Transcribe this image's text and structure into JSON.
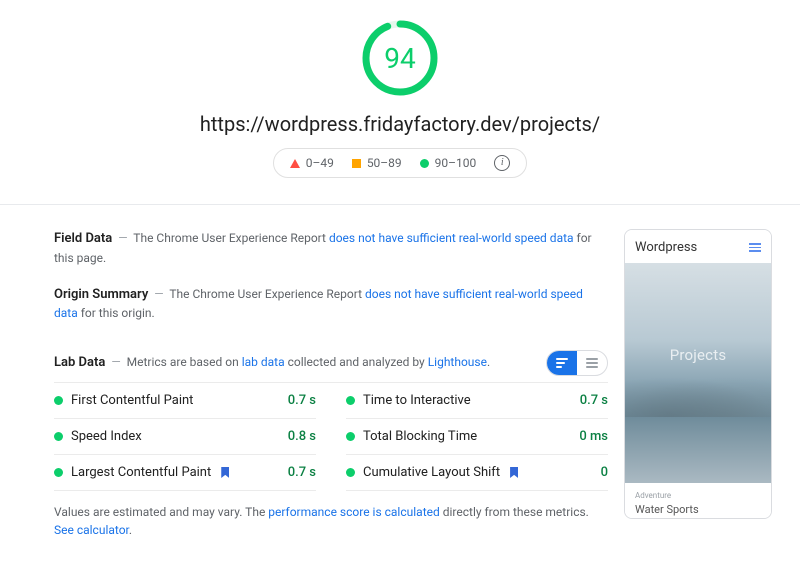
{
  "score": "94",
  "url": "https://wordpress.fridayfactory.dev/projects/",
  "legend": {
    "low": "0–49",
    "mid": "50–89",
    "high": "90–100"
  },
  "fieldData": {
    "title": "Field Data",
    "prefix": "The Chrome User Experience Report ",
    "link": "does not have sufficient real-world speed data",
    "suffix": " for this page."
  },
  "originSummary": {
    "title": "Origin Summary",
    "prefix": "The Chrome User Experience Report ",
    "link": "does not have sufficient real-world speed data",
    "suffix": " for this origin."
  },
  "labData": {
    "title": "Lab Data",
    "prefix": "Metrics are based on ",
    "link1": "lab data",
    "mid": " collected and analyzed by ",
    "link2": "Lighthouse",
    "suffix": "."
  },
  "metrics": [
    {
      "name": "First Contentful Paint",
      "value": "0.7 s",
      "bookmark": false
    },
    {
      "name": "Time to Interactive",
      "value": "0.7 s",
      "bookmark": false
    },
    {
      "name": "Speed Index",
      "value": "0.8 s",
      "bookmark": false
    },
    {
      "name": "Total Blocking Time",
      "value": "0 ms",
      "bookmark": false
    },
    {
      "name": "Largest Contentful Paint",
      "value": "0.7 s",
      "bookmark": true
    },
    {
      "name": "Cumulative Layout Shift",
      "value": "0",
      "bookmark": true
    }
  ],
  "footnote": {
    "prefix": "Values are estimated and may vary. The ",
    "link1": "performance score is calculated",
    "mid": " directly from these metrics. ",
    "link2": "See calculator",
    "suffix": "."
  },
  "preview": {
    "siteName": "Wordpress",
    "heroText": "Projects",
    "tag": "Adventure",
    "cardTitle": "Water Sports"
  },
  "colors": {
    "good": "#0cce6b",
    "avg": "#ffa400",
    "bad": "#ff4e42",
    "link": "#1a73e8"
  }
}
